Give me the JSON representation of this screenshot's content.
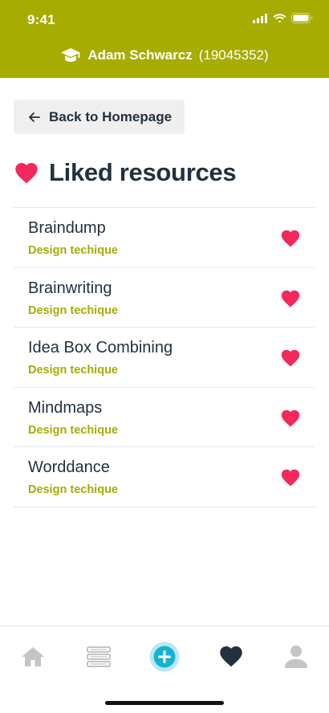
{
  "status_bar": {
    "time": "9:41"
  },
  "header": {
    "user_name": "Adam Schwarcz",
    "user_id": "(19045352)"
  },
  "back_button": {
    "label": "Back to Homepage"
  },
  "page": {
    "title": "Liked resources"
  },
  "resources": [
    {
      "title": "Braindump",
      "category": "Design techique"
    },
    {
      "title": "Brainwriting",
      "category": "Design techique"
    },
    {
      "title": "Idea Box Combining",
      "category": "Design techique"
    },
    {
      "title": "Mindmaps",
      "category": "Design techique"
    },
    {
      "title": "Worddance",
      "category": "Design techique"
    }
  ],
  "tab_bar": {
    "tabs": [
      {
        "icon": "home-icon"
      },
      {
        "icon": "books-icon"
      },
      {
        "icon": "add-icon"
      },
      {
        "icon": "heart-icon",
        "active": true
      },
      {
        "icon": "profile-icon"
      }
    ]
  },
  "colors": {
    "brand": "#a6ac00",
    "heart": "#f2295b",
    "text_dark": "#22303f",
    "add_button": "#15b3d1",
    "tab_inactive": "#c4c4c4"
  }
}
